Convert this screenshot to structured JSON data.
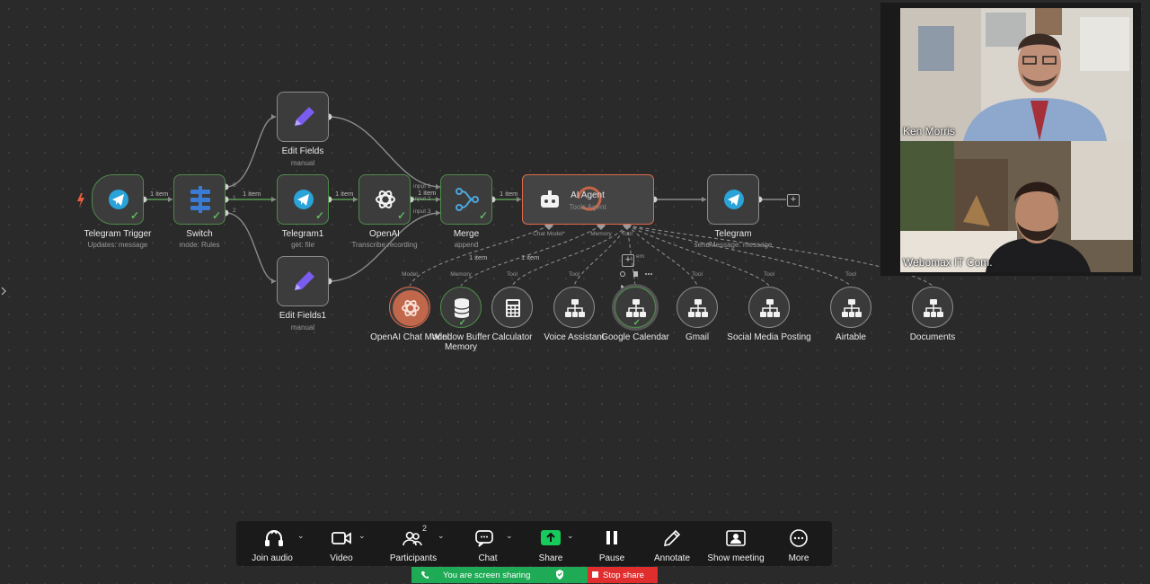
{
  "canvas": {
    "nodes": {
      "telegram_trigger": {
        "title": "Telegram Trigger",
        "subtitle": "Updates: message"
      },
      "switch": {
        "title": "Switch",
        "subtitle": "mode: Rules"
      },
      "edit_fields": {
        "title": "Edit Fields",
        "subtitle": "manual"
      },
      "telegram1": {
        "title": "Telegram1",
        "subtitle": "get: file"
      },
      "edit_fields1": {
        "title": "Edit Fields1",
        "subtitle": "manual"
      },
      "openai": {
        "title": "OpenAI",
        "subtitle": "Transcribe recording"
      },
      "merge": {
        "title": "Merge",
        "subtitle": "append"
      },
      "ai_agent": {
        "title": "AI Agent",
        "subtitle": "Tools Agent"
      },
      "telegram": {
        "title": "Telegram",
        "subtitle": "sendMessage: message"
      }
    },
    "edge_labels": {
      "trigger_switch": "1 item",
      "switch_telegram1": "1 item",
      "telegram1_openai": "1 item",
      "merge_agent": "1 item",
      "model_link": "1 item",
      "memory_link": "1 item"
    },
    "merge_inputs": [
      "input 1",
      "input 2",
      "input 3"
    ],
    "merge_item_label": "1 item",
    "switch_outputs": [
      "0",
      "1",
      "2"
    ],
    "agent_ports": {
      "chat_model": "Chat Model*",
      "memory": "Memory",
      "tool": "Tool"
    },
    "agent_hint": "em",
    "tools": [
      {
        "name": "OpenAI Chat Model",
        "port": "Model",
        "icon": "openai-icon"
      },
      {
        "name": "Window Buffer Memory",
        "port": "Memory",
        "icon": "database-icon"
      },
      {
        "name": "Calculator",
        "port": "Tool",
        "icon": "calculator-icon"
      },
      {
        "name": "Voice Assistant",
        "port": "Tool",
        "icon": "workflow-icon"
      },
      {
        "name": "Google Calendar",
        "port": "",
        "icon": "workflow-icon"
      },
      {
        "name": "Gmail",
        "port": "Tool",
        "icon": "workflow-icon"
      },
      {
        "name": "Social Media Posting",
        "port": "Tool",
        "icon": "workflow-icon"
      },
      {
        "name": "Airtable",
        "port": "Tool",
        "icon": "workflow-icon"
      },
      {
        "name": "Documents",
        "port": "Tool",
        "icon": "workflow-icon"
      }
    ],
    "colors": {
      "success": "#5cb85c",
      "agent_border": "#e06a4a",
      "telegram": "#2aa3d8",
      "switch": "#3a7bd5",
      "edit": "#7b5cf0",
      "link": "#8a8a8a"
    }
  },
  "meeting": {
    "participants": [
      {
        "name": "Ken Morris"
      },
      {
        "name": "Webomax IT Com."
      }
    ],
    "toolbar": {
      "join_audio": "Join audio",
      "video": "Video",
      "participants": "Participants",
      "participants_count": "2",
      "chat": "Chat",
      "share": "Share",
      "pause": "Pause",
      "annotate": "Annotate",
      "show_meeting": "Show meeting",
      "more": "More"
    },
    "sharing_banner": "You are screen sharing",
    "stop_share": "Stop share",
    "colors": {
      "share_green": "#1faa55",
      "stop_red": "#e02d2d",
      "share_icon": "#18c95b"
    }
  }
}
